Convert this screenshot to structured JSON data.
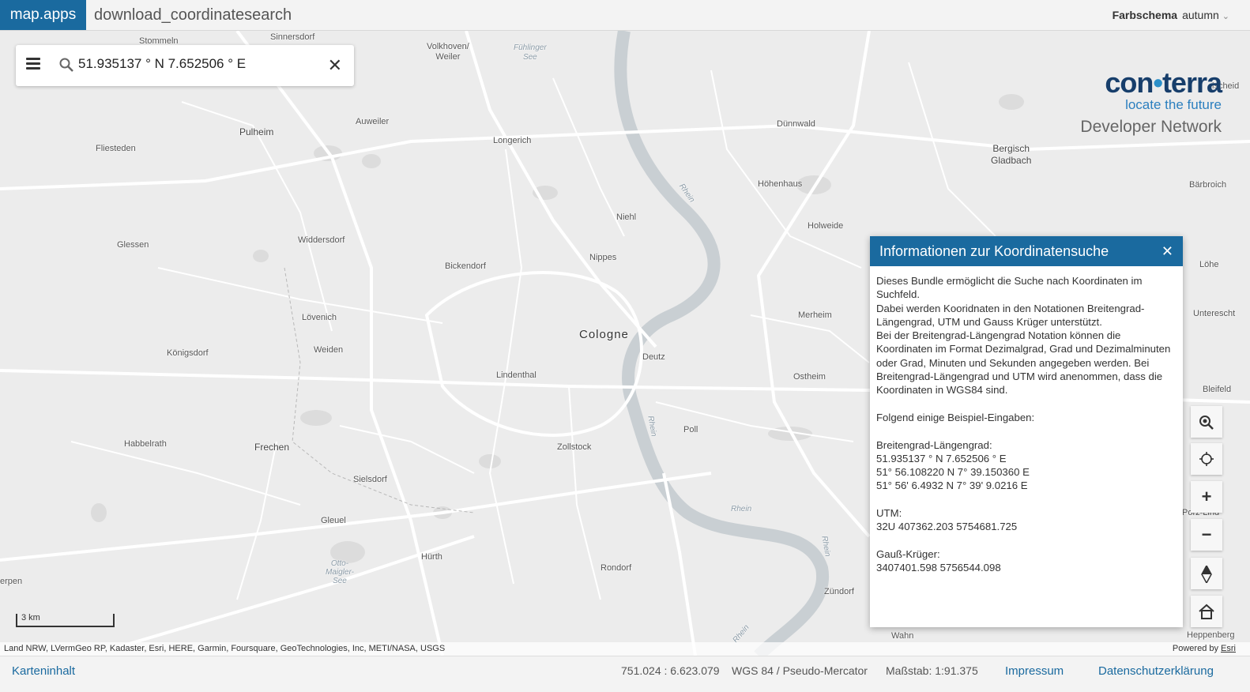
{
  "header": {
    "brand": "map.apps",
    "app_title": "download_coordinatesearch",
    "scheme_label": "Farbschema",
    "scheme_value": "autumn"
  },
  "search": {
    "value": "51.935137 ° N 7.652506 ° E"
  },
  "logo": {
    "word_part1": "con",
    "word_part2": "terra",
    "tagline": "locate the future",
    "subtitle": "Developer Network"
  },
  "map": {
    "places": [
      {
        "name": "Stommeln"
      },
      {
        "name": "Sinnersdorf"
      },
      {
        "name": "Volkhoven/\nWeiler"
      },
      {
        "name": "Fühlinger\nSee"
      },
      {
        "name": "Auweiler"
      },
      {
        "name": "Pulheim"
      },
      {
        "name": "Fliesteden"
      },
      {
        "name": "Longerich"
      },
      {
        "name": "Dünnwald"
      },
      {
        "name": "Bergisch\nGladbach"
      },
      {
        "name": "Höhenhaus"
      },
      {
        "name": "Bärbroich"
      },
      {
        "name": "Niehl"
      },
      {
        "name": "Holweide"
      },
      {
        "name": "Widdersdorf"
      },
      {
        "name": "Glessen"
      },
      {
        "name": "Nippes"
      },
      {
        "name": "Bickendorf"
      },
      {
        "name": "Lövenich"
      },
      {
        "name": "Merheim"
      },
      {
        "name": "Cologne"
      },
      {
        "name": "Weiden"
      },
      {
        "name": "Königsdorf"
      },
      {
        "name": "Deutz"
      },
      {
        "name": "Lindenthal"
      },
      {
        "name": "Ostheim"
      },
      {
        "name": "Poll"
      },
      {
        "name": "Habbelrath"
      },
      {
        "name": "Frechen"
      },
      {
        "name": "Zollstock"
      },
      {
        "name": "Sielsdorf"
      },
      {
        "name": "Gleuel"
      },
      {
        "name": "Hürth"
      },
      {
        "name": "Rondorf"
      },
      {
        "name": "Otto-\nMaigler-\nSee"
      },
      {
        "name": "Zündorf"
      },
      {
        "name": "Wahn"
      },
      {
        "name": "erpen"
      },
      {
        "name": "Löhe"
      },
      {
        "name": "Unterescht"
      },
      {
        "name": "Bleifeld"
      },
      {
        "name": "Heppenberg"
      },
      {
        "name": "Rhein"
      },
      {
        "name": "Rhein"
      },
      {
        "name": "Rhein"
      },
      {
        "name": "Rhein"
      },
      {
        "name": "Rhein"
      },
      {
        "name": "ischeid"
      },
      {
        "name": "Porz-Lind"
      }
    ],
    "scale_label": "3 km"
  },
  "dialog": {
    "title": "Informationen zur Koordinatensuche",
    "body": "Dieses Bundle ermöglicht die Suche nach Koordinaten im Suchfeld.\nDabei werden Kooridnaten in den Notationen Breitengrad-Längengrad, UTM und Gauss Krüger unterstützt.\nBei der Breitengrad-Längengrad Notation können die Koordinaten im Format Dezimalgrad, Grad und Dezimalminuten oder Grad, Minuten und Sekunden angegeben werden. Bei Breitengrad-Längengrad und UTM wird anenommen, dass die Koordinaten in WGS84 sind.\n\nFolgend einige Beispiel-Eingaben:\n\nBreitengrad-Längengrad:\n51.935137 ° N 7.652506 ° E\n51° 56.108220 N 7° 39.150360 E\n51° 56' 6.4932 N 7° 39' 9.0216 E\n\nUTM:\n32U 407362.203 5754681.725\n\nGauß-Krüger:\n3407401.598 5756544.098"
  },
  "attribution": {
    "left": "Land NRW, LVermGeo RP, Kadaster, Esri, HERE, Garmin, Foursquare, GeoTechnologies, Inc, METI/NASA, USGS",
    "powered": "Powered by",
    "esri": "Esri"
  },
  "footer": {
    "map_content": "Karteninhalt",
    "coords": "751.024 : 6.623.079",
    "crs": "WGS 84 / Pseudo-Mercator",
    "scale": "Maßstab: 1:91.375",
    "impressum": "Impressum",
    "privacy": "Datenschutzerklärung"
  },
  "colors": {
    "accent": "#1a6a9f",
    "map_bg": "#ececec",
    "river": "#c9cfd3"
  }
}
